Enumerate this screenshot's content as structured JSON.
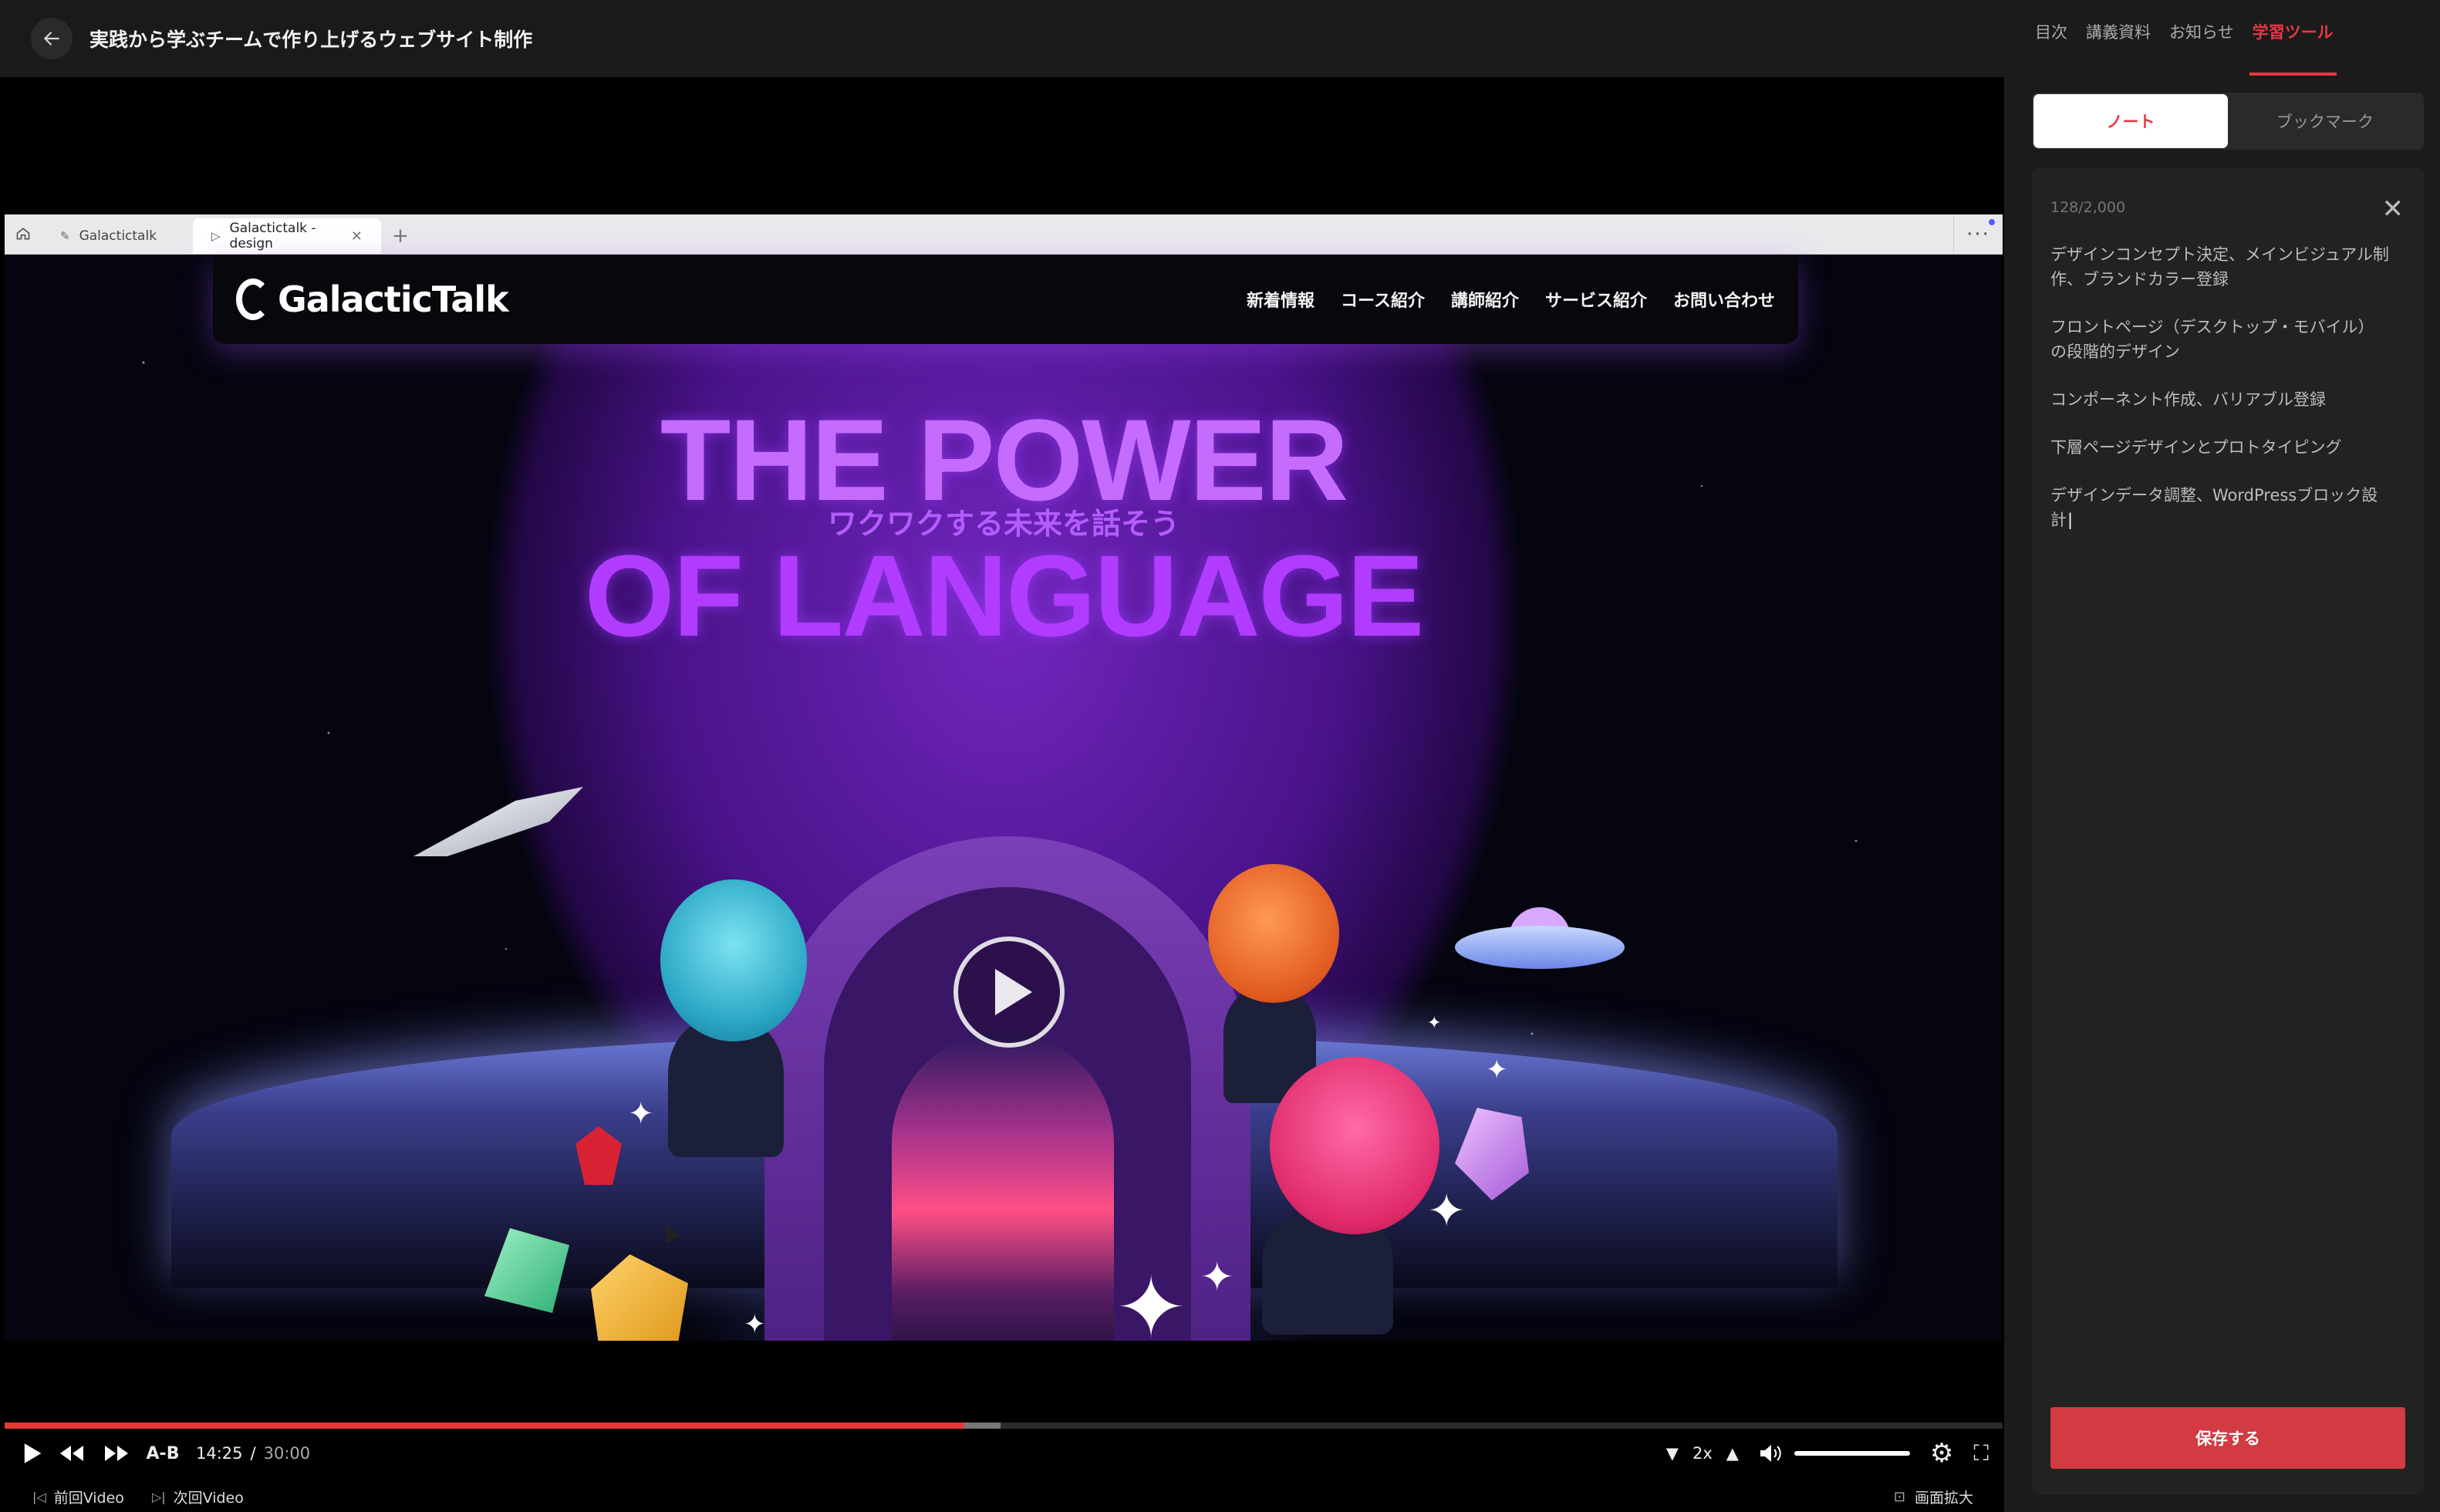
{
  "header": {
    "course_title": "実践から学ぶチームで作り上げるウェブサイト制作"
  },
  "browser": {
    "tabs": [
      {
        "label": "Galactictalk",
        "active": false
      },
      {
        "label": "Galactictalk - design",
        "active": true
      }
    ],
    "new_tab": "+",
    "menu": "···"
  },
  "website": {
    "logo": "GalacticTalk",
    "menu": [
      "新着情報",
      "コース紹介",
      "講師紹介",
      "サービス紹介",
      "お問い合わせ"
    ],
    "headline_line1": "THE POWER",
    "headline_line2": "OF LANGUAGE",
    "subheadline": "ワクワクする未来を話そう"
  },
  "player": {
    "current_time": "14:25",
    "separator": "/",
    "duration": "30:00",
    "played_fraction": 0.4803,
    "buffered_fraction": 0.4983,
    "ab_label": "A-B",
    "speed": "2x",
    "prev_label": "前回Video",
    "next_label": "次回Video",
    "zoom_label": "画面拡大"
  },
  "panel": {
    "tabs": [
      {
        "label": "目次",
        "active": false
      },
      {
        "label": "講義資料",
        "active": false
      },
      {
        "label": "お知らせ",
        "active": false
      },
      {
        "label": "学習ツール",
        "active": true
      }
    ],
    "segments": [
      {
        "label": "ノート",
        "active": true
      },
      {
        "label": "ブックマーク",
        "active": false
      }
    ],
    "note_counter": "128/2,000",
    "notes": [
      "デザインコンセプト決定、メインビジュアル制作、ブランドカラー登録",
      "フロントページ（デスクトップ・モバイル）の段階的デザイン",
      "コンポーネント作成、バリアブル登録",
      "下層ページデザインとプロトタイピング",
      "デザインデータ調整、WordPressブロック設計"
    ],
    "save_label": "保存する"
  },
  "colors": {
    "accent": "#e53945",
    "save_button": "#d23b41",
    "progress_played": "#e53935"
  }
}
